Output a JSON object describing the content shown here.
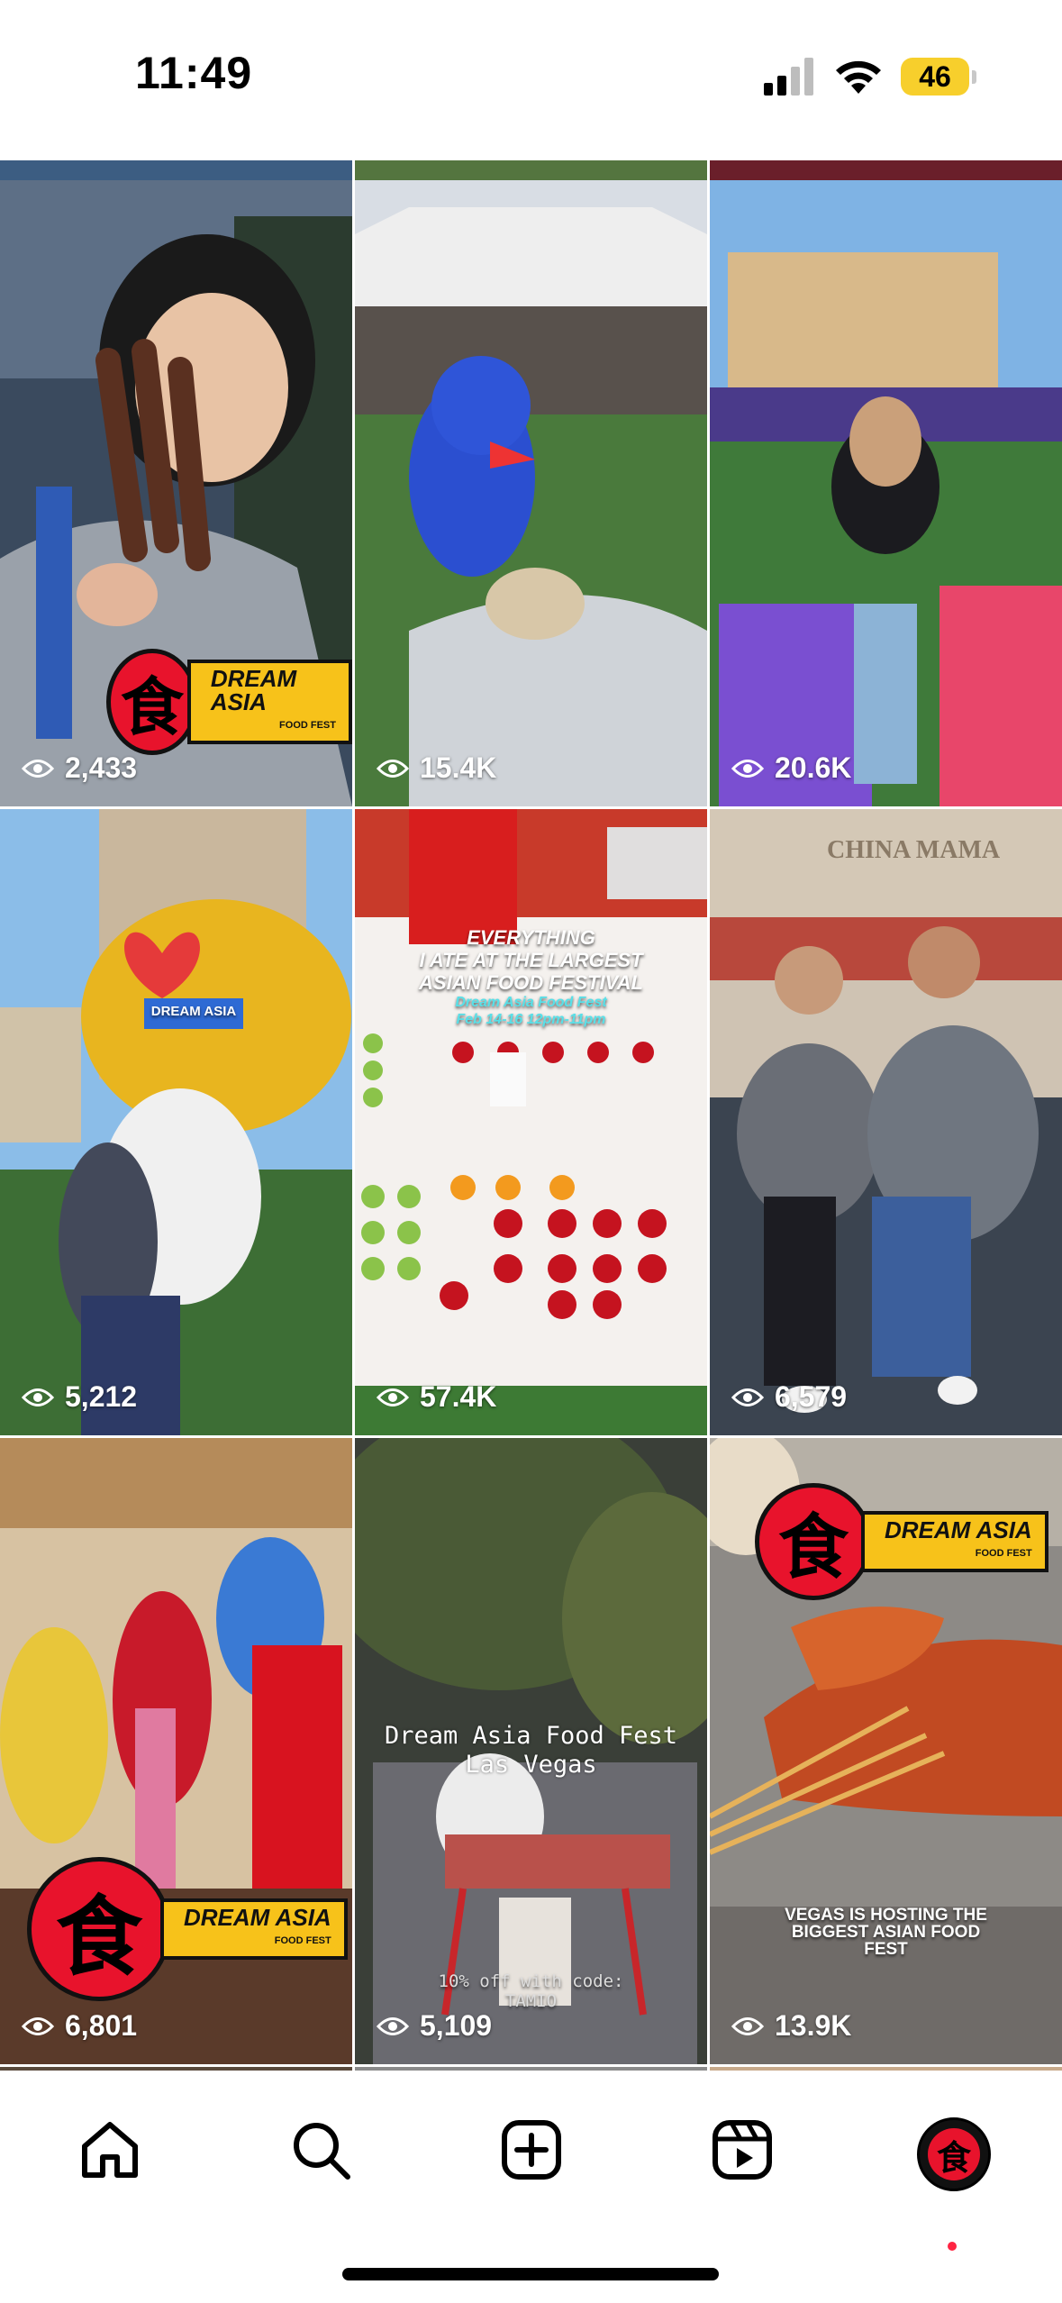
{
  "status_bar": {
    "time": "11:49",
    "battery": "46",
    "icons": [
      "cellular-signal-icon",
      "wifi-icon",
      "battery-icon"
    ]
  },
  "grid": {
    "posts": [
      {
        "views": "2,433",
        "logo_text": "DREAM ASIA",
        "logo_sub": "FOOD FEST"
      },
      {
        "views": "15.4K"
      },
      {
        "views": "20.6K"
      },
      {
        "views": "5,212",
        "sign_text": "DREAM ASIA"
      },
      {
        "views": "57.4K",
        "overlay_line1": "EVERYTHING",
        "overlay_line2": "I ATE AT THE LARGEST",
        "overlay_line3": "ASIAN FOOD FESTIVAL",
        "overlay_line4": "Dream Asia Food Fest",
        "overlay_line5": "Feb 14-16 12pm-11pm"
      },
      {
        "views": "6,579",
        "sign_text": "CHINA MAMA"
      },
      {
        "views": "6,801",
        "logo_text": "DREAM ASIA",
        "logo_sub": "FOOD FEST"
      },
      {
        "views": "5,109",
        "overlay_line1": "Dream Asia Food Fest",
        "overlay_line2": "Las Vegas",
        "overlay_line3": "10% off with code:",
        "overlay_line4": "TAMIO"
      },
      {
        "views": "13.9K",
        "logo_text": "DREAM ASIA",
        "logo_sub": "FOOD FEST",
        "overlay_line1": "VEGAS IS HOSTING THE",
        "overlay_line2": "BIGGEST ASIAN FOOD",
        "overlay_line3": "FEST"
      }
    ]
  },
  "bottom_nav": {
    "items": [
      "home-icon",
      "search-icon",
      "create-post-icon",
      "reels-icon",
      "profile-avatar"
    ],
    "avatar_glyph": "食"
  },
  "logo_glyph": "食",
  "colors": {
    "accent_red": "#e8132c",
    "battery_yellow": "#f7cf2c",
    "logo_yellow": "#f7c21a",
    "notification_dot": "#ff2442"
  }
}
